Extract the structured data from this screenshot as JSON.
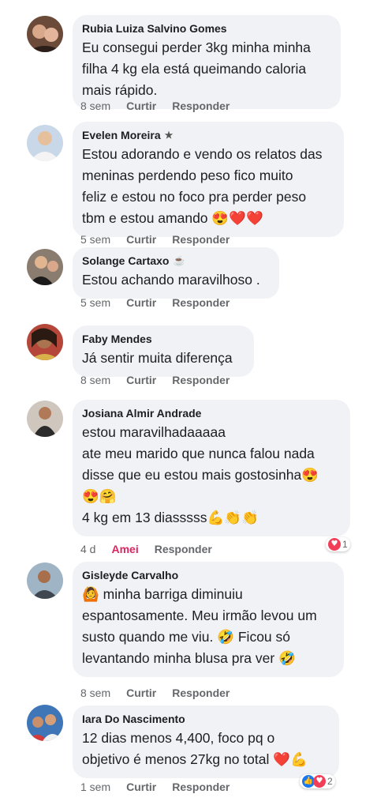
{
  "comments": [
    {
      "author": "Rubia Luiza Salvino Gomes",
      "badge": "",
      "lines": [
        "Eu consegui perder 3kg minha minha",
        "filha 4 kg ela está queimando caloria",
        "mais rápido."
      ],
      "time": "8 sem",
      "like": "Curtir",
      "reply": "Responder"
    },
    {
      "author": "Evelen Moreira",
      "badge": "star-badge",
      "lines": [
        "Estou adorando e vendo os relatos das",
        "meninas perdendo peso fico muito",
        "feliz e estou no foco pra perder peso",
        "tbm e estou amando 😍❤️❤️"
      ],
      "time": "5 sem",
      "like": "Curtir",
      "reply": "Responder"
    },
    {
      "author": "Solange Cartaxo",
      "badge": "coffee-badge",
      "lines": [
        "Estou achando maravilhoso ."
      ],
      "time": "5 sem",
      "like": "Curtir",
      "reply": "Responder"
    },
    {
      "author": "Faby Mendes",
      "badge": "",
      "lines": [
        "Já sentir muita diferença"
      ],
      "time": "8 sem",
      "like": "Curtir",
      "reply": "Responder"
    },
    {
      "author": "Josiana Almir Andrade",
      "badge": "",
      "lines": [
        "estou maravilhadaaaaa",
        "ate meu marido que nunca falou nada",
        "disse que eu estou mais gostosinha😍",
        "😍🤗",
        "4 kg em 13 diasssss💪👏👏"
      ],
      "time": "4 d",
      "like": "Amei",
      "reply": "Responder",
      "reactions": {
        "count": "1",
        "icons": [
          "love"
        ]
      }
    },
    {
      "author": "Gisleyde Carvalho",
      "badge": "",
      "lines": [
        "🙆 minha barriga diminuiu",
        "espantosamente. Meu irmão levou um",
        "susto quando me viu. 🤣 Ficou só",
        "levantando minha blusa pra ver 🤣"
      ],
      "time": "8 sem",
      "like": "Curtir",
      "reply": "Responder"
    },
    {
      "author": "Iara Do Nascimento",
      "badge": "",
      "lines": [
        "12 dias menos 4,400, foco pq o",
        "objetivo é menos 27kg no total ❤️💪"
      ],
      "time": "1 sem",
      "like": "Curtir",
      "reply": "Responder",
      "reactions": {
        "count": "2",
        "icons": [
          "like",
          "love"
        ]
      }
    }
  ],
  "colors": {
    "bubble": "#f0f2f5",
    "meta": "#65676b",
    "love": "#e0245e",
    "like_icon": "#1877f2",
    "love_icon": "#f33e58"
  }
}
